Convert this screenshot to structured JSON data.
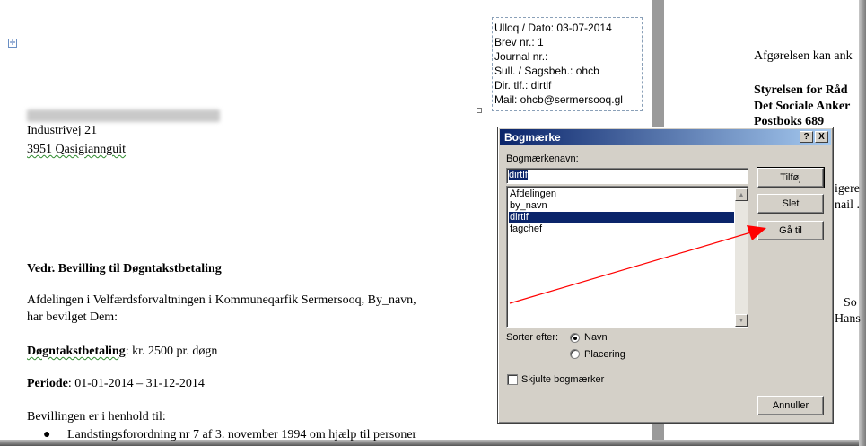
{
  "document": {
    "address_line1": "Industrivej 21",
    "address_line2": "3951 Qasigiannguit",
    "subject": "Vedr. Bevilling til Døgntakstbetaling",
    "para1_line1": "Afdelingen i Velfærdsforvaltningen i Kommuneqarfik Sermersooq, By_navn,",
    "para1_line2": "har bevilget Dem:",
    "amount_label": "Døgntakstbetaling",
    "amount_value": ": kr. 2500 pr. døgn",
    "period_label": "Periode",
    "period_value": ": 01-01-2014 – 31-12-2014",
    "basis": "Bevillingen er i henhold til:",
    "bullet1": "Landstingsforordning nr 7 af 3. november 1994 om hjælp til personer"
  },
  "info_box": {
    "line1": "Ulloq / Dato: 03-07-2014",
    "line2": "Brev nr.: 1",
    "line3": "Journal nr.:",
    "line4": "Sull. / Sagsbeh.: ohcb",
    "line5": "Dir. tlf.: dirtlf",
    "line6": "Mail: ohcb@sermersooq.gl"
  },
  "right_page": {
    "line1": "Afgørelsen kan ank",
    "line2": "Styrelsen for Råd",
    "line3": "Det Sociale Anker",
    "line4": "Postboks 689",
    "line5": "igere",
    "line6": "nail .",
    "line7": "So",
    "line8": "Hans"
  },
  "dialog": {
    "title": "Bogmærke",
    "help_btn": "?",
    "close_btn": "X",
    "name_label": "Bogmærkenavn:",
    "name_value": "dirtlf",
    "items": [
      "Afdelingen",
      "by_navn",
      "dirtlf",
      "fagchef"
    ],
    "selected_index": 2,
    "btn_add": "Tilføj",
    "btn_delete": "Slet",
    "btn_goto": "Gå til",
    "sort_label": "Sorter efter:",
    "sort_name": "Navn",
    "sort_location": "Placering",
    "hide_label": "Skjulte bogmærker",
    "btn_cancel": "Annuller"
  },
  "colors": {
    "title_bar": "#0a246a",
    "selection": "#0a246a",
    "arrow": "#ff0000"
  }
}
